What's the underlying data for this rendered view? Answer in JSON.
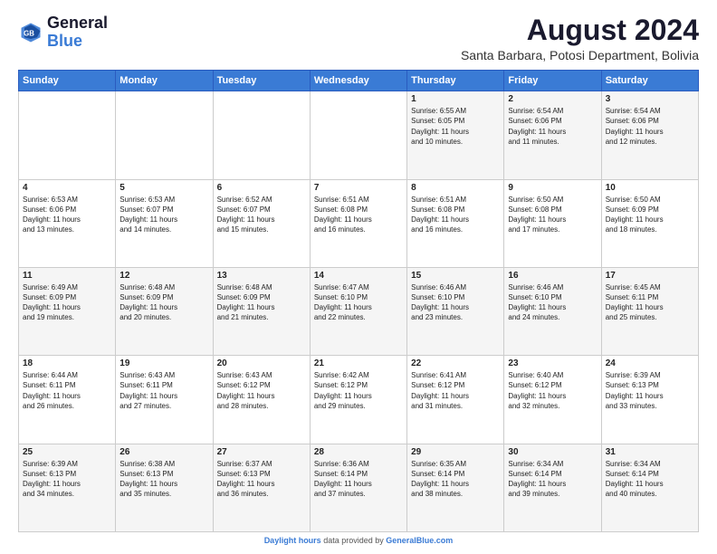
{
  "logo": {
    "line1": "General",
    "line2": "Blue"
  },
  "title": "August 2024",
  "location": "Santa Barbara, Potosi Department, Bolivia",
  "days_of_week": [
    "Sunday",
    "Monday",
    "Tuesday",
    "Wednesday",
    "Thursday",
    "Friday",
    "Saturday"
  ],
  "footer": "Daylight hours",
  "weeks": [
    [
      {
        "day": "",
        "info": ""
      },
      {
        "day": "",
        "info": ""
      },
      {
        "day": "",
        "info": ""
      },
      {
        "day": "",
        "info": ""
      },
      {
        "day": "1",
        "info": "Sunrise: 6:55 AM\nSunset: 6:05 PM\nDaylight: 11 hours\nand 10 minutes."
      },
      {
        "day": "2",
        "info": "Sunrise: 6:54 AM\nSunset: 6:06 PM\nDaylight: 11 hours\nand 11 minutes."
      },
      {
        "day": "3",
        "info": "Sunrise: 6:54 AM\nSunset: 6:06 PM\nDaylight: 11 hours\nand 12 minutes."
      }
    ],
    [
      {
        "day": "4",
        "info": "Sunrise: 6:53 AM\nSunset: 6:06 PM\nDaylight: 11 hours\nand 13 minutes."
      },
      {
        "day": "5",
        "info": "Sunrise: 6:53 AM\nSunset: 6:07 PM\nDaylight: 11 hours\nand 14 minutes."
      },
      {
        "day": "6",
        "info": "Sunrise: 6:52 AM\nSunset: 6:07 PM\nDaylight: 11 hours\nand 15 minutes."
      },
      {
        "day": "7",
        "info": "Sunrise: 6:51 AM\nSunset: 6:08 PM\nDaylight: 11 hours\nand 16 minutes."
      },
      {
        "day": "8",
        "info": "Sunrise: 6:51 AM\nSunset: 6:08 PM\nDaylight: 11 hours\nand 16 minutes."
      },
      {
        "day": "9",
        "info": "Sunrise: 6:50 AM\nSunset: 6:08 PM\nDaylight: 11 hours\nand 17 minutes."
      },
      {
        "day": "10",
        "info": "Sunrise: 6:50 AM\nSunset: 6:09 PM\nDaylight: 11 hours\nand 18 minutes."
      }
    ],
    [
      {
        "day": "11",
        "info": "Sunrise: 6:49 AM\nSunset: 6:09 PM\nDaylight: 11 hours\nand 19 minutes."
      },
      {
        "day": "12",
        "info": "Sunrise: 6:48 AM\nSunset: 6:09 PM\nDaylight: 11 hours\nand 20 minutes."
      },
      {
        "day": "13",
        "info": "Sunrise: 6:48 AM\nSunset: 6:09 PM\nDaylight: 11 hours\nand 21 minutes."
      },
      {
        "day": "14",
        "info": "Sunrise: 6:47 AM\nSunset: 6:10 PM\nDaylight: 11 hours\nand 22 minutes."
      },
      {
        "day": "15",
        "info": "Sunrise: 6:46 AM\nSunset: 6:10 PM\nDaylight: 11 hours\nand 23 minutes."
      },
      {
        "day": "16",
        "info": "Sunrise: 6:46 AM\nSunset: 6:10 PM\nDaylight: 11 hours\nand 24 minutes."
      },
      {
        "day": "17",
        "info": "Sunrise: 6:45 AM\nSunset: 6:11 PM\nDaylight: 11 hours\nand 25 minutes."
      }
    ],
    [
      {
        "day": "18",
        "info": "Sunrise: 6:44 AM\nSunset: 6:11 PM\nDaylight: 11 hours\nand 26 minutes."
      },
      {
        "day": "19",
        "info": "Sunrise: 6:43 AM\nSunset: 6:11 PM\nDaylight: 11 hours\nand 27 minutes."
      },
      {
        "day": "20",
        "info": "Sunrise: 6:43 AM\nSunset: 6:12 PM\nDaylight: 11 hours\nand 28 minutes."
      },
      {
        "day": "21",
        "info": "Sunrise: 6:42 AM\nSunset: 6:12 PM\nDaylight: 11 hours\nand 29 minutes."
      },
      {
        "day": "22",
        "info": "Sunrise: 6:41 AM\nSunset: 6:12 PM\nDaylight: 11 hours\nand 31 minutes."
      },
      {
        "day": "23",
        "info": "Sunrise: 6:40 AM\nSunset: 6:12 PM\nDaylight: 11 hours\nand 32 minutes."
      },
      {
        "day": "24",
        "info": "Sunrise: 6:39 AM\nSunset: 6:13 PM\nDaylight: 11 hours\nand 33 minutes."
      }
    ],
    [
      {
        "day": "25",
        "info": "Sunrise: 6:39 AM\nSunset: 6:13 PM\nDaylight: 11 hours\nand 34 minutes."
      },
      {
        "day": "26",
        "info": "Sunrise: 6:38 AM\nSunset: 6:13 PM\nDaylight: 11 hours\nand 35 minutes."
      },
      {
        "day": "27",
        "info": "Sunrise: 6:37 AM\nSunset: 6:13 PM\nDaylight: 11 hours\nand 36 minutes."
      },
      {
        "day": "28",
        "info": "Sunrise: 6:36 AM\nSunset: 6:14 PM\nDaylight: 11 hours\nand 37 minutes."
      },
      {
        "day": "29",
        "info": "Sunrise: 6:35 AM\nSunset: 6:14 PM\nDaylight: 11 hours\nand 38 minutes."
      },
      {
        "day": "30",
        "info": "Sunrise: 6:34 AM\nSunset: 6:14 PM\nDaylight: 11 hours\nand 39 minutes."
      },
      {
        "day": "31",
        "info": "Sunrise: 6:34 AM\nSunset: 6:14 PM\nDaylight: 11 hours\nand 40 minutes."
      }
    ]
  ]
}
